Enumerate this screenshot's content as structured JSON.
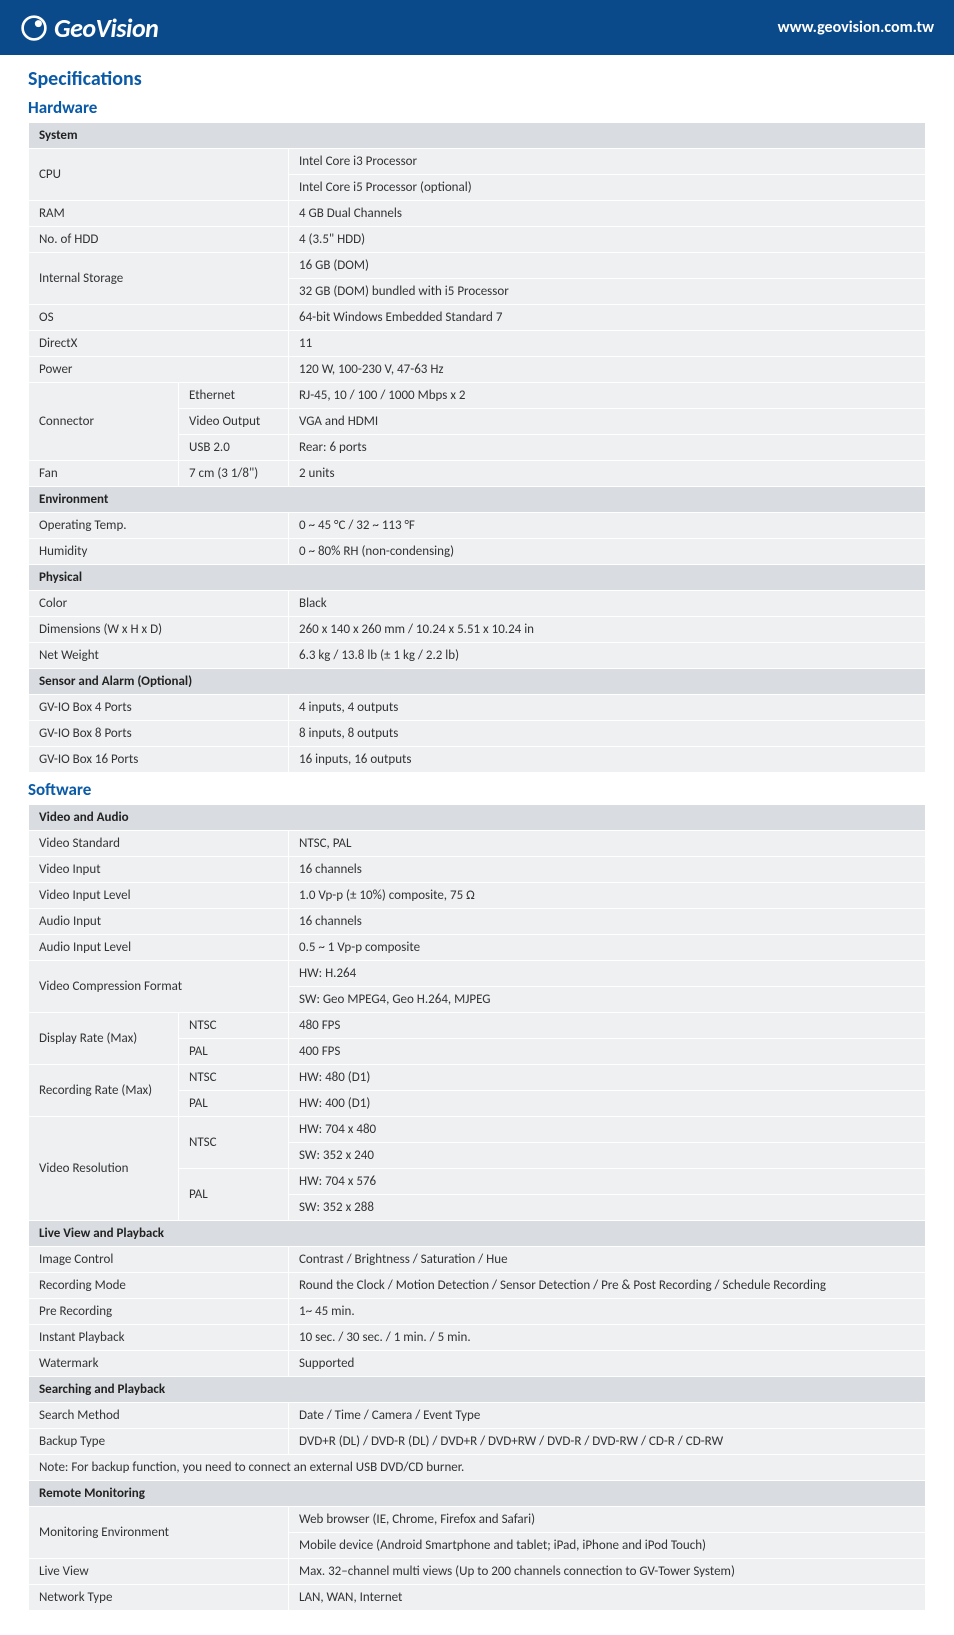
{
  "header": {
    "brand": "GeoVision",
    "url": "www.geovision.com.tw"
  },
  "titles": {
    "specifications": "Specifications",
    "hardware": "Hardware",
    "software": "Software"
  },
  "hardware": {
    "system": {
      "group": "System",
      "cpu_label": "CPU",
      "cpu_1": "Intel Core i3 Processor",
      "cpu_2": "Intel Core i5 Processor (optional)",
      "ram_label": "RAM",
      "ram": "4 GB Dual Channels",
      "hdd_label": "No. of HDD",
      "hdd": "4 (3.5\" HDD)",
      "storage_label": "Internal Storage",
      "storage_1": "16 GB (DOM)",
      "storage_2": "32 GB (DOM) bundled with i5 Processor",
      "os_label": "OS",
      "os": "64-bit Windows Embedded Standard 7",
      "directx_label": "DirectX",
      "directx": "11",
      "power_label": "Power",
      "power": "120 W, 100-230 V, 47-63 Hz",
      "connector_label": "Connector",
      "eth_label": "Ethernet",
      "eth": "RJ-45, 10 / 100 / 1000 Mbps x 2",
      "vout_label": "Video Output",
      "vout": "VGA and HDMI",
      "usb_label": "USB 2.0",
      "usb": "Rear: 6 ports",
      "fan_label": "Fan",
      "fan_sub": "7 cm (3 1/8\")",
      "fan": "2 units"
    },
    "environment": {
      "group": "Environment",
      "optemp_label": "Operating Temp.",
      "optemp": "0 ~ 45 °C / 32 ~ 113 °F",
      "humidity_label": "Humidity",
      "humidity": "0 ~ 80% RH (non-condensing)"
    },
    "physical": {
      "group": "Physical",
      "color_label": "Color",
      "color": "Black",
      "dim_label": "Dimensions (W x H x D)",
      "dim": "260 x 140 x 260 mm / 10.24 x 5.51 x 10.24 in",
      "weight_label": "Net Weight",
      "weight": "6.3 kg / 13.8 lb (± 1 kg / 2.2 lb)"
    },
    "sensor": {
      "group": "Sensor and Alarm (Optional)",
      "p4_label": "GV-IO Box 4 Ports",
      "p4": "4 inputs, 4 outputs",
      "p8_label": "GV-IO Box 8 Ports",
      "p8": "8 inputs, 8 outputs",
      "p16_label": "GV-IO Box 16 Ports",
      "p16": "16 inputs, 16 outputs"
    }
  },
  "software": {
    "va": {
      "group": "Video and Audio",
      "vstd_label": "Video Standard",
      "vstd": "NTSC, PAL",
      "vin_label": "Video Input",
      "vin": "16 channels",
      "vinlvl_label": "Video Input Level",
      "vinlvl": "1.0 Vp-p (± 10%) composite, 75 Ω",
      "ain_label": "Audio Input",
      "ain": "16 channels",
      "ainlvl_label": "Audio Input Level",
      "ainlvl": "0.5 ~ 1 Vp-p composite",
      "vcf_label": "Video Compression Format",
      "vcf_1": "HW: H.264",
      "vcf_2": "SW: Geo MPEG4, Geo H.264, MJPEG",
      "disp_label": "Display Rate (Max)",
      "ntsc_label": "NTSC",
      "pal_label": "PAL",
      "disp_ntsc": "480 FPS",
      "disp_pal": "400 FPS",
      "rec_label": "Recording Rate (Max)",
      "rec_ntsc": "HW: 480 (D1)",
      "rec_pal": "HW: 400 (D1)",
      "vres_label": "Video Resolution",
      "vres_ntsc_1": "HW: 704 x 480",
      "vres_ntsc_2": "SW: 352 x 240",
      "vres_pal_1": "HW: 704 x 576",
      "vres_pal_2": "SW: 352 x 288"
    },
    "lvp": {
      "group": "Live View and Playback",
      "imgctl_label": "Image Control",
      "imgctl": "Contrast / Brightness / Saturation / Hue",
      "recmode_label": "Recording Mode",
      "recmode": "Round the Clock / Motion Detection / Sensor Detection / Pre & Post Recording / Schedule Recording",
      "prerec_label": "Pre Recording",
      "prerec": "1~ 45 min.",
      "instpb_label": "Instant Playback",
      "instpb": "10 sec. / 30 sec. / 1 min. / 5 min.",
      "wm_label": "Watermark",
      "wm": "Supported"
    },
    "sp": {
      "group": "Searching and Playback",
      "search_label": "Search Method",
      "search": "Date / Time / Camera / Event Type",
      "backup_label": "Backup Type",
      "backup": "DVD+R (DL) / DVD-R (DL) / DVD+R / DVD+RW / DVD-R / DVD-RW / CD-R / CD-RW",
      "note": "Note: For backup function, you need to connect an external USB DVD/CD burner."
    },
    "rm": {
      "group": "Remote Monitoring",
      "env_label": "Monitoring Environment",
      "env_1": "Web browser (IE, Chrome, Firefox and Safari)",
      "env_2": "Mobile device (Android Smartphone and tablet; iPad, iPhone and iPod Touch)",
      "lv_label": "Live View",
      "lv": "Max. 32–channel multi views (Up to 200 channels connection to GV-Tower System)",
      "nt_label": "Network Type",
      "nt": "LAN, WAN, Internet"
    }
  }
}
